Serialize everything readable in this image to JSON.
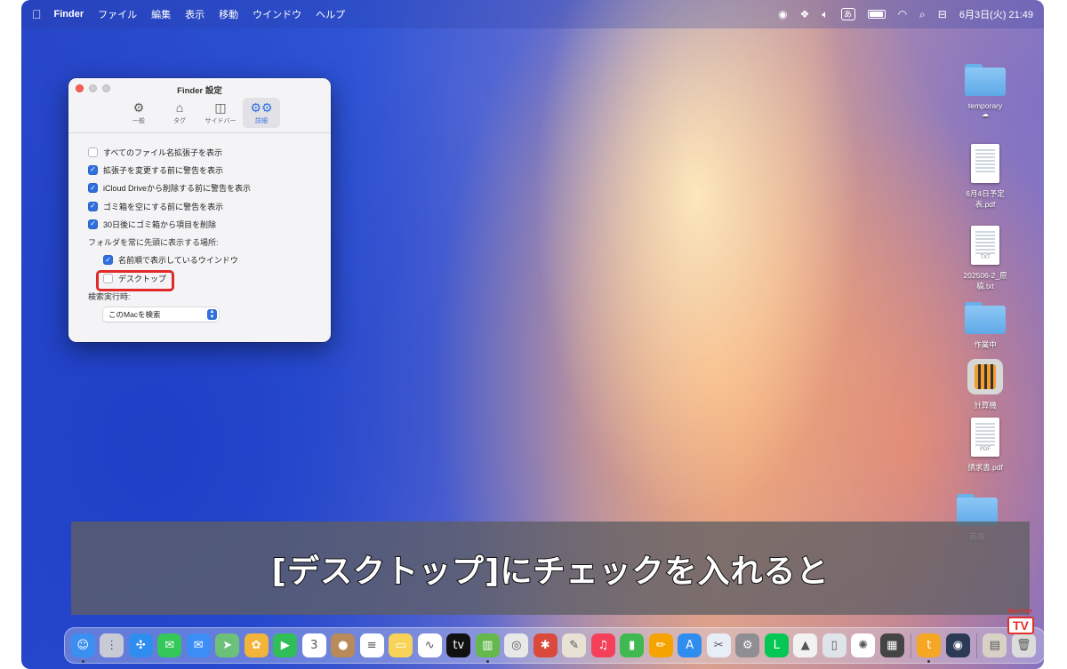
{
  "menubar": {
    "app_name": "Finder",
    "menus": [
      "ファイル",
      "編集",
      "表示",
      "移動",
      "ウインドウ",
      "ヘルプ"
    ],
    "input_badge": "あ",
    "clock": "6月3日(火)  21:49"
  },
  "finder_settings": {
    "title": "Finder 設定",
    "tabs": [
      {
        "label": "一般",
        "icon": "gear-icon",
        "active": false
      },
      {
        "label": "タグ",
        "icon": "tag-icon",
        "active": false
      },
      {
        "label": "サイドバー",
        "icon": "sidebar-icon",
        "active": false
      },
      {
        "label": "詳細",
        "icon": "gears-icon",
        "active": true
      }
    ],
    "options": [
      {
        "label": "すべてのファイル名拡張子を表示",
        "checked": false
      },
      {
        "label": "拡張子を変更する前に警告を表示",
        "checked": true
      },
      {
        "label": "iCloud Driveから削除する前に警告を表示",
        "checked": true
      },
      {
        "label": "ゴミ箱を空にする前に警告を表示",
        "checked": true
      },
      {
        "label": "30日後にゴミ箱から項目を削除",
        "checked": true
      }
    ],
    "folders_on_top_label": "フォルダを常に先頭に表示する場所:",
    "folders_on_top_options": [
      {
        "label": "名前順で表示しているウインドウ",
        "checked": true
      },
      {
        "label": "デスクトップ",
        "checked": false
      }
    ],
    "search_label": "検索実行時:",
    "search_value": "このMacを検索"
  },
  "desktop_items": [
    {
      "label": "temporary",
      "kind": "folder"
    },
    {
      "label": "6月4日予定表.pdf",
      "kind": "document",
      "ext": ""
    },
    {
      "label": "202506-2_原稿.txt",
      "kind": "document",
      "ext": "TXT"
    },
    {
      "label": "作業中",
      "kind": "folder"
    },
    {
      "label": "計算機",
      "kind": "app"
    },
    {
      "label": "請求書.pdf",
      "kind": "document",
      "ext": "PDF"
    },
    {
      "label": "画像",
      "kind": "folder"
    }
  ],
  "caption": "[デスクトップ]にチェックを入れると",
  "dock_apps": [
    {
      "name": "finder-icon",
      "color": "#3b8ff0",
      "glyph": "☺"
    },
    {
      "name": "launchpad-icon",
      "color": "#c8cbd6",
      "glyph": "⋮"
    },
    {
      "name": "safari-icon",
      "color": "#2f8df0",
      "glyph": "✣"
    },
    {
      "name": "messages-icon",
      "color": "#34c759",
      "glyph": "✉"
    },
    {
      "name": "mail-icon",
      "color": "#3a8ef6",
      "glyph": "✉"
    },
    {
      "name": "maps-icon",
      "color": "#6cc17a",
      "glyph": "➤"
    },
    {
      "name": "photos-icon",
      "color": "#f3b43b",
      "glyph": "✿"
    },
    {
      "name": "facetime-icon",
      "color": "#2fbf56",
      "glyph": "▶"
    },
    {
      "name": "calendar-icon",
      "color": "#ffffff",
      "glyph": "3"
    },
    {
      "name": "contacts-icon",
      "color": "#b98a5a",
      "glyph": "●"
    },
    {
      "name": "reminders-icon",
      "color": "#ffffff",
      "glyph": "≡"
    },
    {
      "name": "notes-icon",
      "color": "#f7d35a",
      "glyph": "▭"
    },
    {
      "name": "freeform-icon",
      "color": "#ffffff",
      "glyph": "∿"
    },
    {
      "name": "tv-icon",
      "color": "#111111",
      "glyph": "tv"
    },
    {
      "name": "numbers-icon",
      "color": "#65b84b",
      "glyph": "▥"
    },
    {
      "name": "chrome-icon",
      "color": "#e8e8e8",
      "glyph": "◎"
    },
    {
      "name": "toolbox-icon",
      "color": "#d94a3c",
      "glyph": "✱"
    },
    {
      "name": "pages-icon",
      "color": "#e8e2d4",
      "glyph": "✎"
    },
    {
      "name": "music-icon",
      "color": "#f5405a",
      "glyph": "♫"
    },
    {
      "name": "keynote-numbers-icon",
      "color": "#3fb950",
      "glyph": "▮"
    },
    {
      "name": "pencil-app-icon",
      "color": "#f4a300",
      "glyph": "✏"
    },
    {
      "name": "app-store-icon",
      "color": "#2f8df0",
      "glyph": "A"
    },
    {
      "name": "xcode-icon",
      "color": "#e8eef8",
      "glyph": "✂"
    },
    {
      "name": "system-settings-icon",
      "color": "#8e8e93",
      "glyph": "⚙"
    },
    {
      "name": "line-icon",
      "color": "#06c755",
      "glyph": "L"
    },
    {
      "name": "affinity-icon",
      "color": "#f2f2f2",
      "glyph": "▲"
    },
    {
      "name": "iphone-mirroring-icon",
      "color": "#dfe3ea",
      "glyph": "▯"
    },
    {
      "name": "chatgpt-icon",
      "color": "#ffffff",
      "glyph": "✺"
    },
    {
      "name": "calculator-icon",
      "color": "#444444",
      "glyph": "▦"
    },
    {
      "name": "typeface-icon",
      "color": "#f5a623",
      "glyph": "t"
    },
    {
      "name": "quicktime-icon",
      "color": "#2b3a55",
      "glyph": "◉"
    },
    {
      "name": "preview-icon",
      "color": "#d8d2c6",
      "glyph": "▤"
    },
    {
      "name": "trash-icon",
      "color": "#dcdcdc",
      "glyph": "🗑"
    }
  ],
  "brand": {
    "small": "Mac Fan",
    "tv": "TV"
  }
}
